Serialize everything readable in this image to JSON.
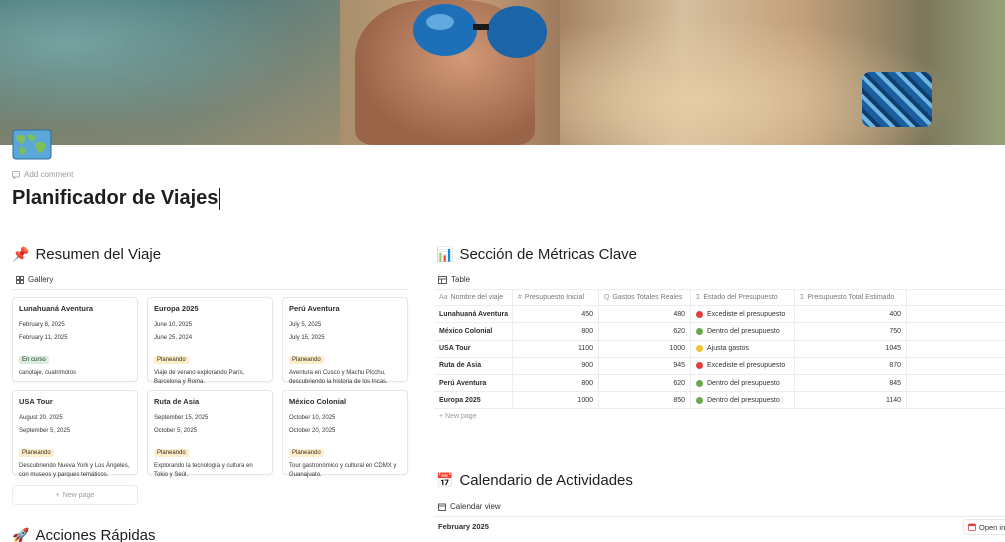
{
  "page": {
    "add_comment": "Add comment",
    "title": "Planificador de Viajes"
  },
  "icons": {
    "page_icon": "world-map-icon",
    "comment": "comment-icon"
  },
  "summary": {
    "emoji": "📌",
    "heading": "Resumen del Viaje",
    "view_label": "Gallery",
    "new_page": "New page",
    "cards": [
      {
        "title": "Lunahuaná Aventura",
        "date1": "February 8, 2025",
        "date2": "February 11, 2025",
        "status": "En curso",
        "status_color": "green",
        "desc": "canotaje, cuatrimotos"
      },
      {
        "title": "Europa 2025",
        "date1": "June 10, 2025",
        "date2": "June 25, 2024",
        "status": "Planeando",
        "status_color": "yellow",
        "desc": "Viaje de verano explorando París, Barcelona y Roma."
      },
      {
        "title": "Perú Aventura",
        "date1": "July 5, 2025",
        "date2": "July 15, 2025",
        "status": "Planeando",
        "status_color": "yellow",
        "desc": "Aventura en Cusco y Machu Picchu, descubriendo la historia de los Incas."
      },
      {
        "title": "USA Tour",
        "date1": "August 20, 2025",
        "date2": "September 5, 2025",
        "status": "Planeando",
        "status_color": "yellow",
        "desc": "Descubriendo Nueva York y Los Ángeles, con museos y parques temáticos."
      },
      {
        "title": "Ruta de Asia",
        "date1": "September 15, 2025",
        "date2": "October 5, 2025",
        "status": "Planeando",
        "status_color": "yellow",
        "desc": "Explorando la tecnología y cultura en Tokio y Seúl."
      },
      {
        "title": "México Colonial",
        "date1": "October 10, 2025",
        "date2": "October 20, 2025",
        "status": "Planeando",
        "status_color": "yellow",
        "desc": "Tour gastronómico y cultural en CDMX y Guanajuato."
      }
    ]
  },
  "metrics": {
    "emoji": "📊",
    "heading": "Sección de Métricas Clave",
    "view_label": "Table",
    "new_page": "New page",
    "columns": [
      "Nombre del viaje",
      "Presupuesto Inicial",
      "Gastos Totales Reales",
      "Estado del Presupuesto",
      "Presupuesto Total Estimado"
    ],
    "column_icons": [
      "Aa",
      "#",
      "Q",
      "Σ",
      "Σ"
    ],
    "rows": [
      {
        "name": "Lunahuaná Aventura",
        "initial": "450",
        "actual": "480",
        "status": "Excediste el presupuesto",
        "status_color": "#e03e3e",
        "estimated": "400"
      },
      {
        "name": "México Colonial",
        "initial": "800",
        "actual": "620",
        "status": "Dentro del presupuesto",
        "status_color": "#6aa84f",
        "estimated": "750"
      },
      {
        "name": "USA Tour",
        "initial": "1100",
        "actual": "1000",
        "status": "Ajusta gastos",
        "status_color": "#f1c232",
        "estimated": "1045"
      },
      {
        "name": "Ruta de Asia",
        "initial": "900",
        "actual": "945",
        "status": "Excediste el presupuesto",
        "status_color": "#e03e3e",
        "estimated": "870"
      },
      {
        "name": "Perú Aventura",
        "initial": "800",
        "actual": "620",
        "status": "Dentro del presupuesto",
        "status_color": "#6aa84f",
        "estimated": "845"
      },
      {
        "name": "Europa 2025",
        "initial": "1000",
        "actual": "850",
        "status": "Dentro del presupuesto",
        "status_color": "#6aa84f",
        "estimated": "1140"
      }
    ]
  },
  "calendar": {
    "emoji": "📅",
    "heading": "Calendario de Actividades",
    "view_label": "Calendar view",
    "month": "February 2025",
    "open_label": "Open in"
  },
  "actions": {
    "emoji": "🚀",
    "heading": "Acciones Rápidas"
  }
}
